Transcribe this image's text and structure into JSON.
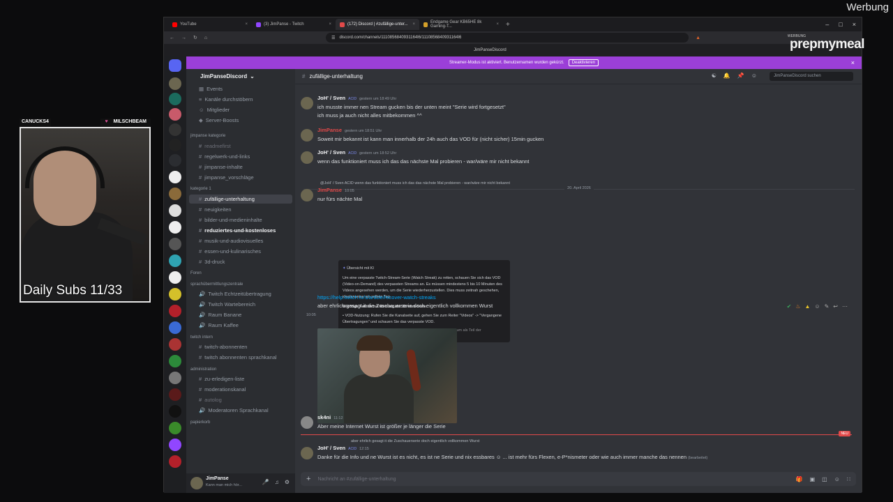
{
  "overlay": {
    "werbung": "Werbung",
    "cam_tab_left": "CANUCKS4",
    "cam_tab_right": "MILSCHBEAM",
    "daily_subs": "Daily Subs 11/33",
    "sponsor_logo": "prepmymeal"
  },
  "browser": {
    "tabs": [
      {
        "label": "YouTube",
        "color": "#ff0000"
      },
      {
        "label": "(3) JimPanse - Twitch",
        "color": "#9146ff"
      },
      {
        "label": "(172) Discord | #zufällige-unter...",
        "color": "#e24a4a"
      },
      {
        "label": "Endgame Gear KB65HE 8k Gaming-T...",
        "color": "#d4a02a"
      }
    ],
    "url": "discord.com/channels/1110856840931164l6/1110856840931164l6",
    "page_title": "JimPanseDiscord",
    "werbung_small": "WERBUNG"
  },
  "banner": {
    "text": "Streamer-Modus ist aktiviert. Benutzernamen wurden gekürzt.",
    "button": "Deaktivieren"
  },
  "server": {
    "name": "JimPanseDiscord",
    "channel_name": "zufällige-unterhaltung",
    "search_placeholder": "JimPanseDiscord suchen"
  },
  "sidebar": {
    "top": [
      "Events",
      "Kanäle durchstöbern",
      "Mitglieder",
      "Server-Boosts"
    ],
    "cat1": "jimpanse kategorie",
    "cat1_items": [
      "readmefirst",
      "regelwerk-und-links",
      "jimpanse-inhalte",
      "jimpanse_vorschläge"
    ],
    "cat2": "kategorie 1",
    "cat2_items": [
      "zufällige-unterhaltung",
      "neuigkeiten",
      "bilder-und-medieninhalte",
      "reduziertes-und-kostenloses",
      "musik-und-audiovisuelles",
      "essen-und-kulinarisches",
      "3d-druck"
    ],
    "foren": "Foren",
    "cat3": "sprachübermittlungszentrale",
    "cat3_items": [
      "Twitch Echtzeitübertragung",
      "Twitch Wartebereich",
      "Raum Banane",
      "Raum Kaffee"
    ],
    "cat4": "twitch intern",
    "cat4_items": [
      "twitch-abonnenten",
      "twitch abonnenten sprachkanal"
    ],
    "cat5": "administration",
    "cat5_items": [
      "zu-erledigen-liste",
      "moderationskanal",
      "autolog",
      "Moderatoren Sprachkanal"
    ],
    "cat6": "papierkorb",
    "user_name": "JimPanse",
    "user_status": "Kann man mich hör..."
  },
  "messages": [
    {
      "user": "JoH' / Sven",
      "tag": "ACID",
      "time": "gestern um 18:49 Uhr",
      "lines": [
        "ich musste immer nen Stream gucken bis der unten meint \"Serie wird fortgesetzt\"",
        "ich muss ja auch nicht alles mitbekommen ^^"
      ]
    },
    {
      "user": "JimPanse",
      "time": "gestern um 18:51 Uhr",
      "lines": [
        "Soweit mir bekannt ist kann man innerhalb der 24h auch das VOD für (nicht sicher) 15min gucken"
      ]
    },
    {
      "user": "JoH' / Sven",
      "tag": "ACID",
      "time": "gestern um 18:52 Uhr",
      "lines": [
        "wenn das funktioniert muss ich das das nächste Mal probieren - war/wäre mir nicht bekannt"
      ]
    }
  ],
  "date_divider": "20. April 2026",
  "reply": {
    "quoted": "@JoH' / Sven  ACID  wenn das funktioniert muss ich das das nächste Mal probieren - war/wäre mir nicht bekannt",
    "user": "JimPanse",
    "time": "10:05",
    "text": "nur fürs nächte Mal"
  },
  "ai_box": {
    "heading": "Übersicht mit KI",
    "p1": "Um eine verpasste Twitch-Stream-Serie (Watch Streak) zu retten, schauen Sie sich das VOD (Video-on-Demand) des verpassten Streams an. Es müssen mindestens 5 bis 10 Minuten des Videos angesehen werden, um die Serie wiederherzustellen. Dies muss zeitnah geschehen, idealerweise am selben Tag.",
    "facts_title": "Wichtige Fakten zur Rettung der Stream-Serie:",
    "bullet1": "VOD-Nutzung: Rufen Sie die Kanalseite auf, gehen Sie zum Reiter \"Videos\" -> \"Vergangene Übertragungen\" und schauen Sie das verpasste VOD.",
    "bullet2": "Dauer: Ein Stream muss in der Regel länger als 10 Minuten sein, um als Teil der"
  },
  "link": "https://help.twitch.tv/s/article/recover-watch-streaks",
  "link_line2": "aber ehrlich gesagt it die Zuschauerserie doch eigentlich vollkommen Wurst",
  "gif_time": "10:05",
  "msg_sk4ni": {
    "user": "sk4ni",
    "time": "11:12",
    "text": "Aber meine Internet Wurst ist größer je länger die Serie"
  },
  "new_badge": "NEU",
  "last_reply": {
    "quoted": "aber ehrlich gesagt it die Zuschauerserie doch eigentlich vollkommen Wurst",
    "user": "JoH' / Sven",
    "tag": "ACID",
    "time": "12:15",
    "text": "Danke für die Info und ne Wurst ist es nicht, es ist ne Serie und nix essbares ☺ ... ist mehr fürs Flexen, e-P*nismeter oder wie auch immer manche das nennen",
    "edited": "(bearbeitet)"
  },
  "composer_placeholder": "Nachricht an #zufällige-unterhaltung"
}
